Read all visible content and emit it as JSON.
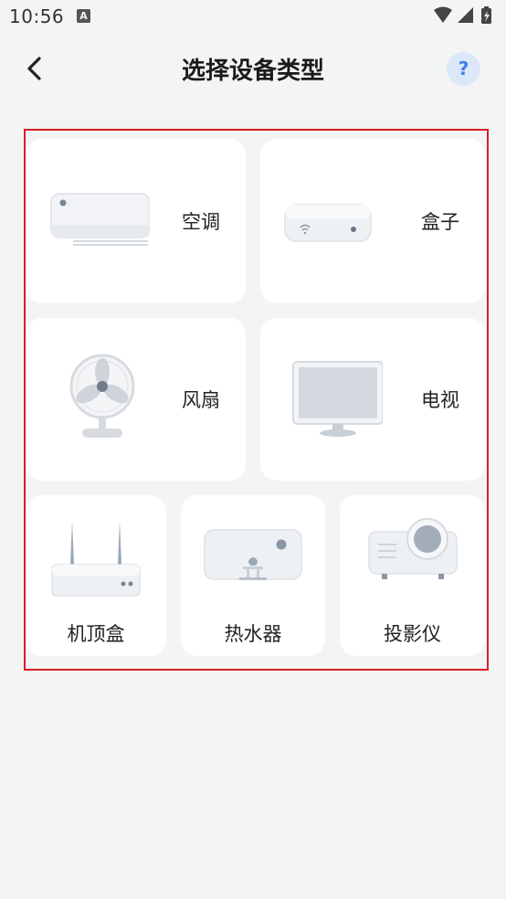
{
  "status_bar": {
    "time": "10:56",
    "notification_icon": "A"
  },
  "header": {
    "title": "选择设备类型",
    "help_label": "?"
  },
  "devices": [
    {
      "label": "空调",
      "icon": "air-conditioner-icon"
    },
    {
      "label": "盒子",
      "icon": "box-icon"
    },
    {
      "label": "风扇",
      "icon": "fan-icon"
    },
    {
      "label": "电视",
      "icon": "tv-icon"
    },
    {
      "label": "机顶盒",
      "icon": "set-top-box-icon"
    },
    {
      "label": "热水器",
      "icon": "water-heater-icon"
    },
    {
      "label": "投影仪",
      "icon": "projector-icon"
    }
  ],
  "colors": {
    "background": "#f3f5f5",
    "card": "#ffffff",
    "highlight_border": "#d62020",
    "help_bg": "#dce7fa",
    "help_fg": "#3f7fe8"
  }
}
